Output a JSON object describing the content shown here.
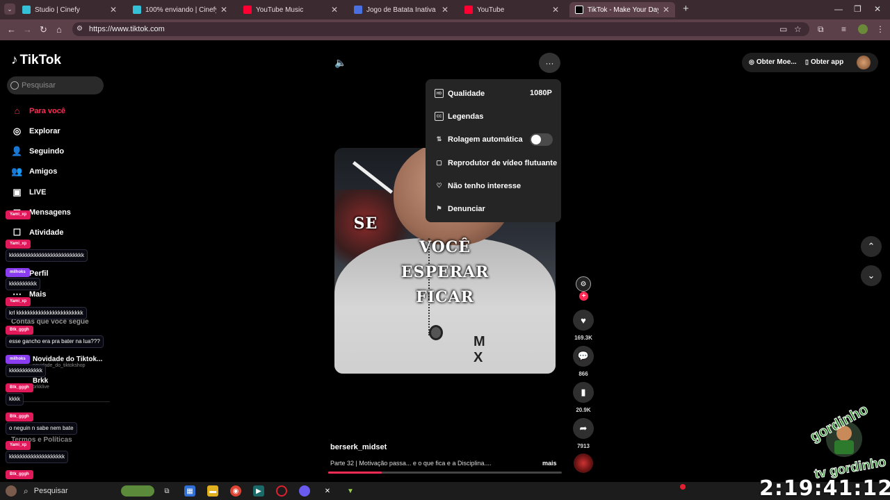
{
  "browser": {
    "tabs": [
      {
        "title": "Studio | Cinefy",
        "color": "#35c0d8",
        "active": false
      },
      {
        "title": "100% enviando | Cinefy",
        "color": "#35c0d8",
        "active": false
      },
      {
        "title": "YouTube Music",
        "color": "#ff0033",
        "active": false
      },
      {
        "title": "Jogo de Batata Inativa | Jogue",
        "color": "#4a6fe0",
        "active": false
      },
      {
        "title": "YouTube",
        "color": "#ff0033",
        "active": false
      },
      {
        "title": "TikTok - Make Your Day",
        "color": "#000000",
        "active": true
      }
    ],
    "url": "https://www.tiktok.com"
  },
  "tiktok": {
    "logo": "TikTok",
    "search_placeholder": "Pesquisar",
    "nav": [
      {
        "label": "Para você",
        "icon": "home-icon",
        "active": true
      },
      {
        "label": "Explorar",
        "icon": "compass-icon",
        "active": false
      },
      {
        "label": "Seguindo",
        "icon": "following-icon",
        "active": false
      },
      {
        "label": "Amigos",
        "icon": "friends-icon",
        "active": false
      },
      {
        "label": "LIVE",
        "icon": "live-icon",
        "active": false
      },
      {
        "label": "Mensagens",
        "icon": "messages-icon",
        "active": false
      },
      {
        "label": "Atividade",
        "icon": "activity-icon",
        "active": false
      },
      {
        "label": "Perfil",
        "icon": "profile-icon",
        "active": false
      },
      {
        "label": "Mais",
        "icon": "more-icon",
        "active": false
      }
    ],
    "following_heading": "Contas que você segue",
    "following": [
      {
        "name": "Novidade do Tiktok...",
        "handle": "novidade_do_tiktokshop"
      },
      {
        "name": "Brkk",
        "handle": "brkklive"
      }
    ],
    "footer_link": "Termos e Políticas",
    "video": {
      "caption_lines": [
        "SE",
        "VOCÊ",
        "ESPERAR",
        "FICAR"
      ],
      "author": "berserk_midset",
      "description": "Parte 32 | Motivação passa... e o que fica e a Disciplina....",
      "more": "mais",
      "progress": 0.23
    },
    "menu": {
      "items": [
        {
          "label": "Qualidade",
          "icon": "hd-icon",
          "value": "1080P"
        },
        {
          "label": "Legendas",
          "icon": "captions-icon"
        },
        {
          "label": "Rolagem automática",
          "icon": "autoscroll-icon",
          "toggle": false
        },
        {
          "label": "Reprodutor de vídeo flutuante",
          "icon": "floating-player-icon"
        },
        {
          "label": "Não tenho interesse",
          "icon": "heart-broken-icon"
        },
        {
          "label": "Denunciar",
          "icon": "flag-icon"
        }
      ]
    },
    "actions": {
      "likes": "169.3K",
      "comments": "866",
      "saves": "20.9K",
      "shares": "7913"
    },
    "top_right": {
      "coins": "Obter Moe...",
      "app": "Obter app"
    }
  },
  "chat": [
    {
      "user": "Yami_xp",
      "color": "#e0195a",
      "msg": ""
    },
    {
      "user": "Yami_xp",
      "color": "#e0195a",
      "msg": "kkkkkkkkkkkkkkkkkkkkkkkkkkk"
    },
    {
      "user": "milhoks",
      "color": "#8a3cf0",
      "msg": "kkkkkkkkkk"
    },
    {
      "user": "Yami_xp",
      "color": "#e0195a",
      "msg": "krl kkkkkkkkkkkkkkkkkkkkkkkk"
    },
    {
      "user": "Btk_gggh",
      "color": "#e0195a",
      "msg": "esse gancho era pra bater na lua???"
    },
    {
      "user": "milhoks",
      "color": "#8a3cf0",
      "msg": "kkkkkkkkkkkk"
    },
    {
      "user": "Btk_gggh",
      "color": "#e0195a",
      "msg": "kkkk"
    },
    {
      "user": "Btk_gggh",
      "color": "#e0195a",
      "msg": "o neguin n sabe nem bate"
    },
    {
      "user": "Yami_xp",
      "color": "#e0195a",
      "msg": "kkkkkkkkkkkkkkkkkkkk"
    },
    {
      "user": "Btk_gggh",
      "color": "#e0195a",
      "msg": ""
    }
  ],
  "taskbar": {
    "search": "Pesquisar",
    "clock": "2:19:41:12"
  },
  "watermark": "gordinho tv"
}
